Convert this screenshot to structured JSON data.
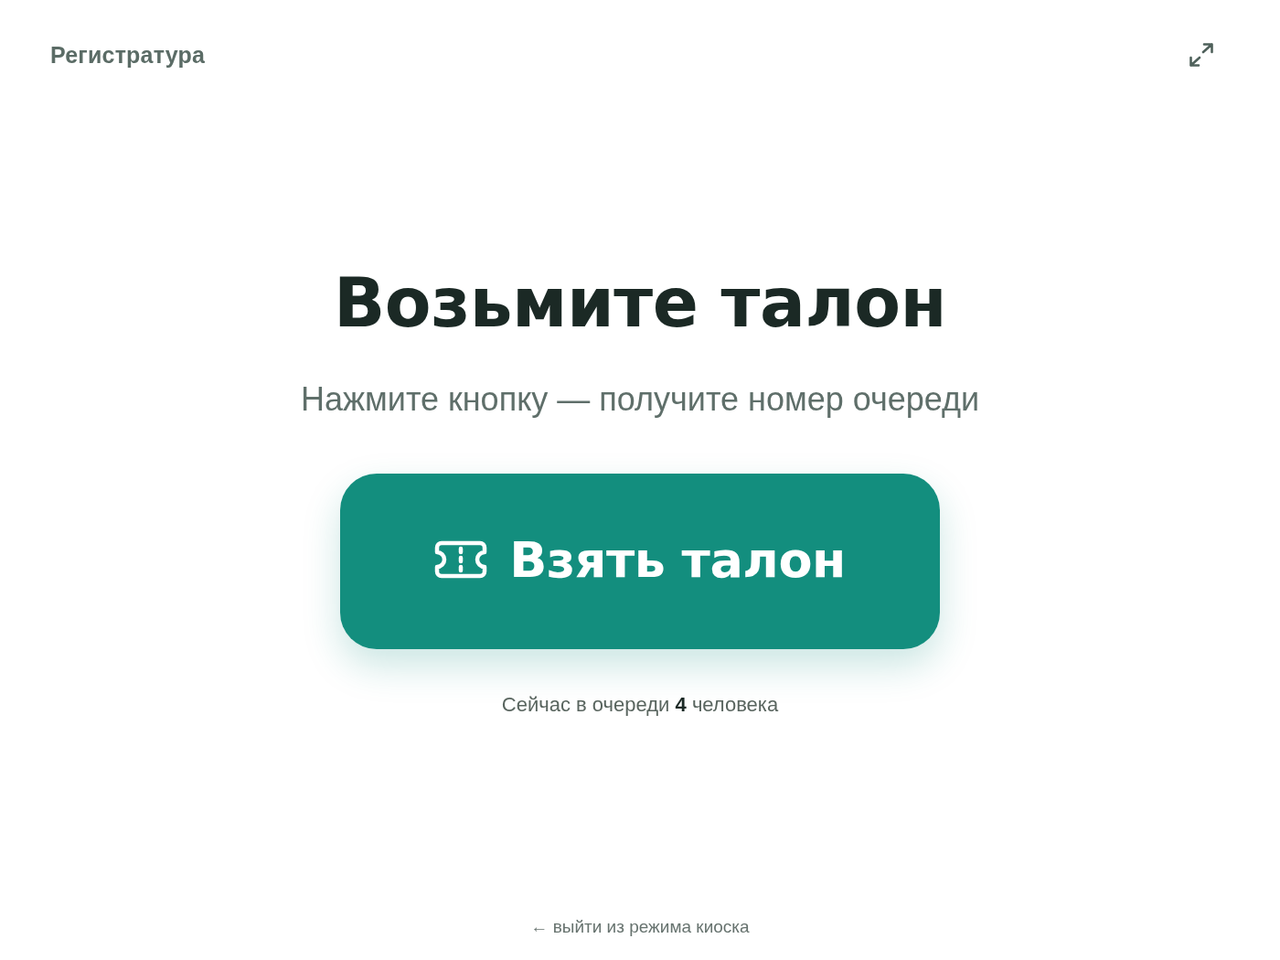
{
  "header": {
    "title": "Регистратура"
  },
  "main": {
    "heading": "Возьмите талон",
    "subtitle": "Нажмите кнопку — получите номер очереди",
    "button": {
      "label": "Взять талон"
    },
    "queue_info": "Сейчас в очереди **4** человека"
  },
  "footer": {
    "exit_link": "← выйти из режима киоска"
  }
}
